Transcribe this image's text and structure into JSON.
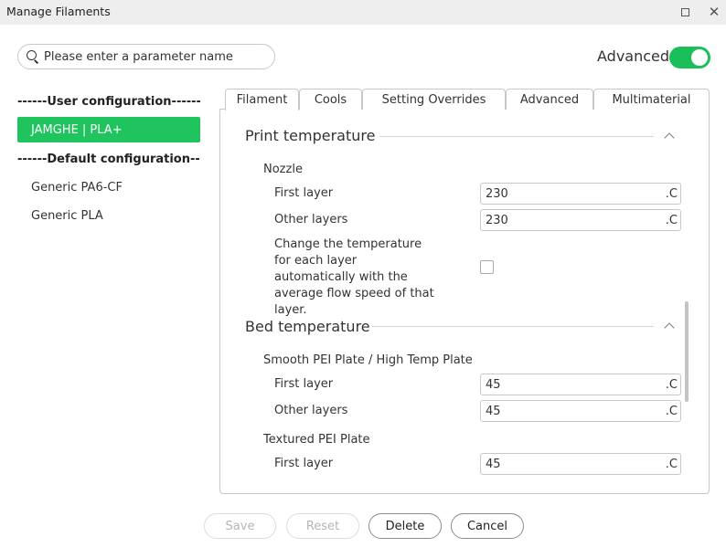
{
  "window": {
    "title": "Manage Filaments"
  },
  "search": {
    "placeholder": "Please enter a parameter name"
  },
  "advanced": {
    "label": "Advanced",
    "enabled": true
  },
  "sidebar": {
    "user_header": "------User configuration------",
    "user_items": [
      "JAMGHE | PLA+"
    ],
    "default_header": "------Default configuration------",
    "default_items": [
      "Generic PA6-CF",
      "Generic PLA"
    ]
  },
  "tabs": [
    "Filament",
    "Cools",
    "Setting Overrides",
    "Advanced",
    "Multimaterial"
  ],
  "active_tab": "Filament",
  "print_temperature": {
    "title": "Print temperature",
    "group": "Nozzle",
    "first_layer_label": "First layer",
    "first_layer_value": "230",
    "other_layers_label": "Other layers",
    "other_layers_value": "230",
    "unit": ".C",
    "auto_label": "Change the temperature for each layer automatically with the average flow speed of that layer.",
    "auto_checked": false
  },
  "bed_temperature": {
    "title": "Bed temperature",
    "group1": "Smooth PEI Plate / High Temp Plate",
    "g1_first_label": "First layer",
    "g1_first_value": "45",
    "g1_other_label": "Other layers",
    "g1_other_value": "45",
    "group2": "Textured PEI Plate",
    "g2_first_label": "First layer",
    "g2_first_value": "45",
    "unit": ".C"
  },
  "buttons": {
    "save": "Save",
    "reset": "Reset",
    "delete": "Delete",
    "cancel": "Cancel"
  },
  "colors": {
    "accent_green": "#1fc45f",
    "toggle_green": "#1bbf5a"
  }
}
